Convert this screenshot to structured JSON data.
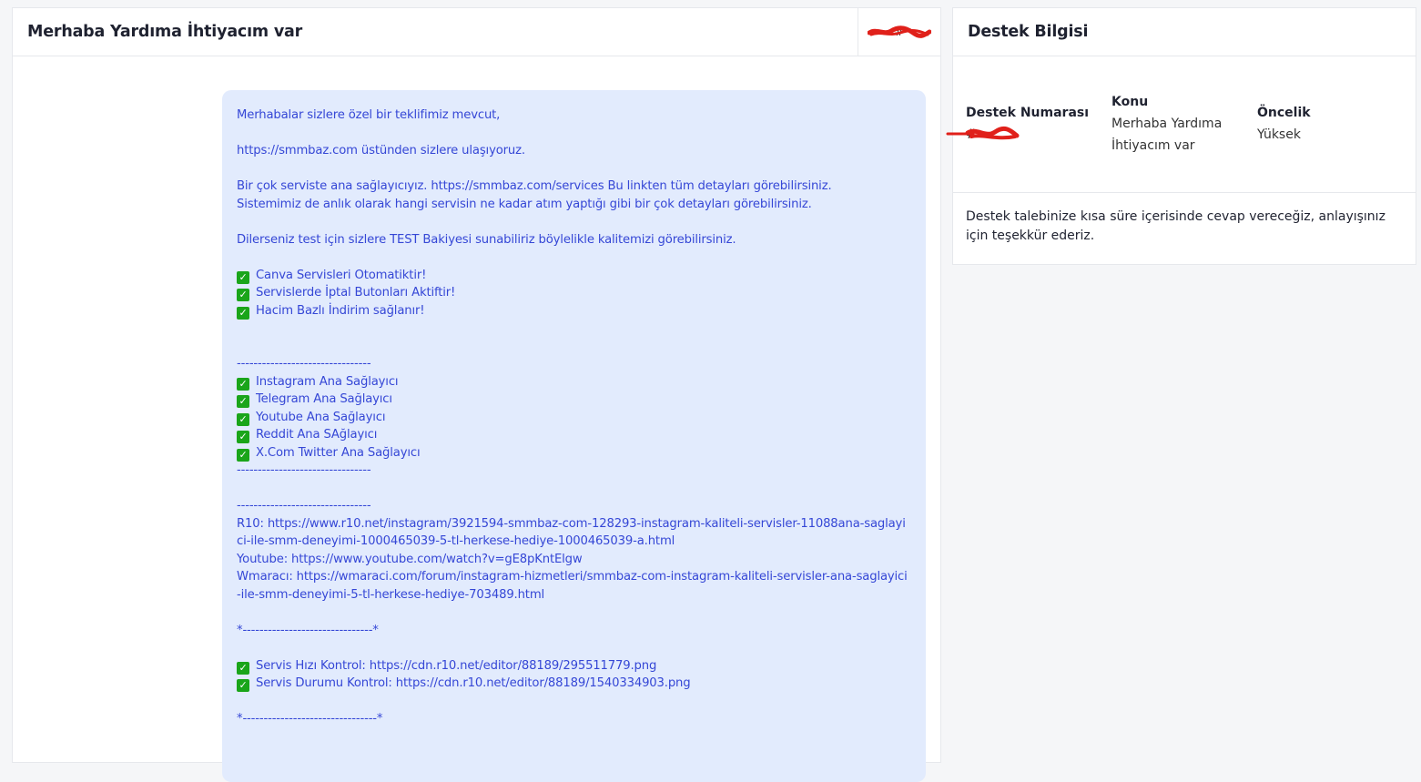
{
  "ticket": {
    "title": "Merhaba Yardıma İhtiyacım var",
    "id_text": "#"
  },
  "message": {
    "line_1": "Merhabalar sizlere özel bir teklifimiz mevcut,",
    "line_3": "https://smmbaz.com üstünden sizlere ulaşıyoruz.",
    "line_5": "Bir çok serviste ana sağlayıcıyız. https://smmbaz.com/services Bu linkten tüm detayları görebilirsiniz.",
    "line_6": "Sistemimiz de anlık olarak hangi servisin ne kadar atım yaptığı gibi bir çok detayları görebilirsiniz.",
    "line_8": "Dilerseniz test için sizlere TEST Bakiyesi sunabiliriz böylelikle kalitemizi görebilirsiniz.",
    "features": [
      "Canva Servisleri Otomatiktir!",
      "Servislerde İptal Butonları Aktiftir!",
      "Hacim Bazlı İndirim sağlanır!"
    ],
    "divider": "--------------------------------",
    "providers": [
      "Instagram Ana Sağlayıcı",
      "Telegram Ana Sağlayıcı",
      "Youtube Ana Sağlayıcı",
      "Reddit Ana SAğlayıcı",
      "X.Com Twitter Ana Sağlayıcı"
    ],
    "r10_line": "R10: https://www.r10.net/instagram/3921594-smmbaz-com-128293-instagram-kaliteli-servisler-11088ana-saglayici-ile-smm-deneyimi-1000465039-5-tl-herkese-hediye-1000465039-a.html",
    "youtube_line": "Youtube: https://www.youtube.com/watch?v=gE8pKntElgw",
    "wmaraci_line": "Wmaracı: https://wmaraci.com/forum/instagram-hizmetleri/smmbaz-com-instagram-kaliteli-servisler-ana-saglayici-ile-smm-deneyimi-5-tl-herkese-hediye-703489.html",
    "star_divider_1": "*-------------------------------*",
    "checks": [
      "Servis Hızı Kontrol: https://cdn.r10.net/editor/88189/295511779.png",
      "Servis Durumu Kontrol: https://cdn.r10.net/editor/88189/1540334903.png"
    ],
    "star_divider_2": "*--------------------------------*"
  },
  "info": {
    "title": "Destek Bilgisi",
    "number_label": "Destek Numarası",
    "number_value": "#",
    "subject_label": "Konu",
    "subject_value": "Merhaba Yardıma İhtiyacım var",
    "priority_label": "Öncelik",
    "priority_value": "Yüksek",
    "note": "Destek talebinize kısa süre içerisinde cevap vereceğiz, anlayışınız için teşekkür ederiz."
  },
  "colors": {
    "message_bg": "#e2ebfd",
    "message_text": "#3547d6",
    "check_green": "#1aa51a",
    "redaction": "#e0201a"
  }
}
